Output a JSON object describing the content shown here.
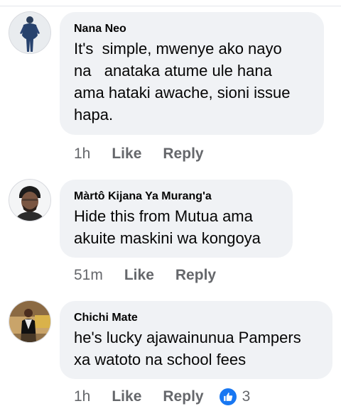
{
  "comments": [
    {
      "author": "Nana Neo",
      "text": "It's  simple, mwenye ako nayo\nna   anataka atume ule hana\nama hataki awache, sioni issue\nhapa.",
      "time": "1h",
      "like_label": "Like",
      "reply_label": "Reply"
    },
    {
      "author": "Màrtô Kijana Ya Murang'a",
      "text": "Hide this from Mutua ama\nakuite maskini wa kongoya",
      "time": "51m",
      "like_label": "Like",
      "reply_label": "Reply"
    },
    {
      "author": "Chichi Mate",
      "text": "he's lucky ajawainunua Pampers\nxa watoto na school fees",
      "time": "1h",
      "like_label": "Like",
      "reply_label": "Reply",
      "reaction_count": "3",
      "reaction_icon": "like-icon"
    }
  ],
  "colors": {
    "bubble": "#f0f2f5",
    "meta_text": "#65676b",
    "like_blue": "#1877f2"
  }
}
